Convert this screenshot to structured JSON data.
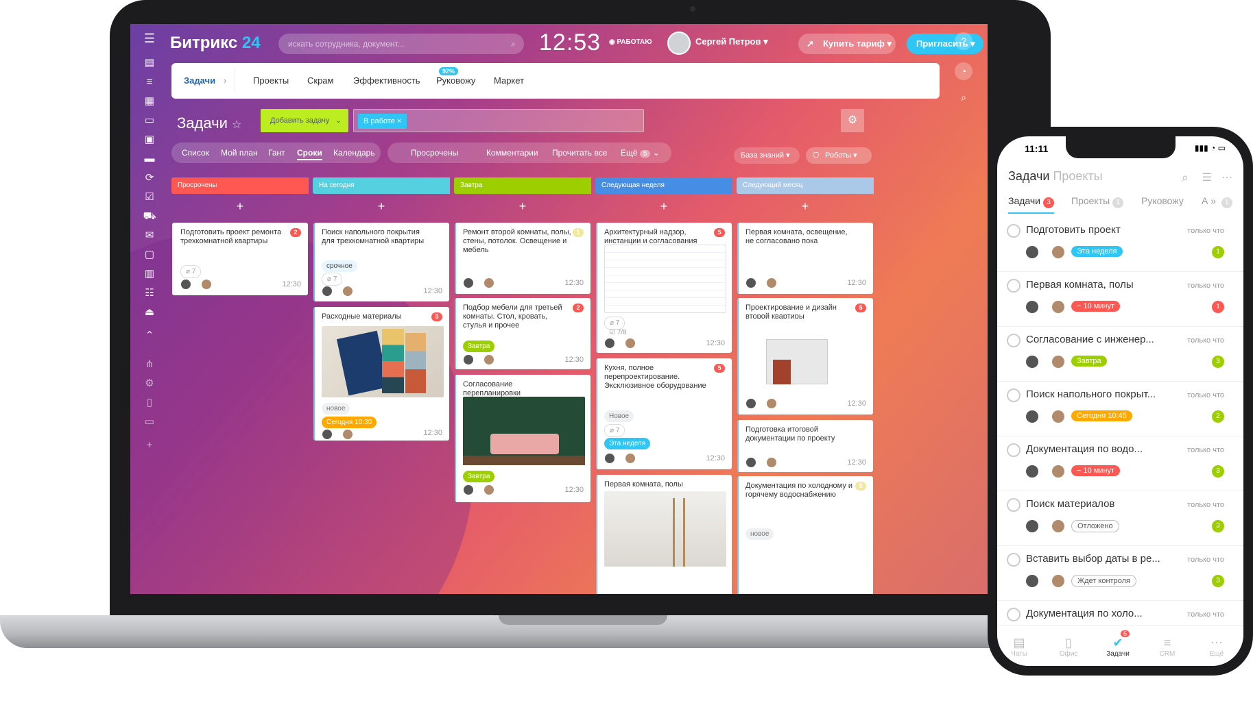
{
  "header": {
    "logo_main": "Битрикс",
    "logo_num": "24",
    "search_placeholder": "искать сотрудника, документ...",
    "clock": "12:53",
    "work_status": "РАБОТАЮ",
    "user_name": "Сергей Петров",
    "buy_label": "Купить тариф",
    "invite_label": "Пригласить"
  },
  "top_menu": {
    "items": [
      "Задачи",
      "Проекты",
      "Скрам",
      "Эффективность",
      "Руковожу",
      "Маркет"
    ],
    "efficiency_badge": "92%"
  },
  "toolbar": {
    "title": "Задачи",
    "add_task": "Добавить задачу",
    "filter_chip": "В работе"
  },
  "views": [
    "Список",
    "Мой план",
    "Гант",
    "Сроки",
    "Календарь"
  ],
  "counters": {
    "overdue": "Просрочены",
    "comments": "Комментарии",
    "read_all": "Прочитать все",
    "more": "Ещё",
    "more_count": "5"
  },
  "right_tools": {
    "knowledge": "База знаний",
    "robots": "Роботы"
  },
  "columns": [
    {
      "title": "Просрочены",
      "color": "#ff5752"
    },
    {
      "title": "На сегодня",
      "color": "#55d0e0"
    },
    {
      "title": "Завтра",
      "color": "#9dcf00"
    },
    {
      "title": "Следующая неделя",
      "color": "#468ee5"
    },
    {
      "title": "Следующий месяц",
      "color": "#aac8e8"
    }
  ],
  "cards": {
    "c1": {
      "title": "Подготовить проект ремонта трехкомнатной квартиры",
      "count": "2",
      "files": "7",
      "time": "12:30"
    },
    "c2": {
      "title": "Поиск напольного покрытия для трехкомнатной квартиры",
      "tag": "срочное",
      "files": "7",
      "time": "12:30"
    },
    "c3": {
      "title": "Расходные материалы",
      "count": "5",
      "tag": "новое",
      "deadline": "Сегодня 10:30",
      "time": "12:30"
    },
    "c4": {
      "title": "Ремонт второй комнаты, полы, стены, потолок. Освещение и мебель",
      "count": "1",
      "time": "12:30"
    },
    "c5": {
      "title": "Подбор мебели для третьей комнаты. Стол, кровать, стулья и прочее",
      "count": "2",
      "deadline": "Завтра",
      "time": "12:30"
    },
    "c6": {
      "title": "Согласование перепланировки",
      "deadline": "Завтра",
      "time": "12:30"
    },
    "c7": {
      "title": "Архитектурный надзор, инстанции и согласования",
      "count": "5",
      "files": "7",
      "checklist": "7/8",
      "time": "12:30"
    },
    "c8": {
      "title": "Кухня, полное перепроектирование. Эксклюзивное оборудование",
      "count": "5",
      "tag": "Новое",
      "files": "7",
      "deadline": "Эта неделя",
      "time": "12:30"
    },
    "c9": {
      "title": "Первая комната, полы"
    },
    "c10": {
      "title": "Первая комната, освещение, не согласовано пока",
      "time": "12:30"
    },
    "c11": {
      "title": "Проектирование и дизайн второй квартиры",
      "count": "5",
      "time": "12:30"
    },
    "c12": {
      "title": "Подготовка итоговой документации по проекту",
      "time": "12:30"
    },
    "c13": {
      "title": "Документация по холодному и горячему водоснабжению",
      "count": "5",
      "tag": "новое"
    }
  },
  "phone": {
    "time": "11:11",
    "title": "Задачи",
    "subtitle": "Проекты",
    "tabs": [
      {
        "label": "Задачи",
        "count": "3"
      },
      {
        "label": "Проекты",
        "count": "1"
      },
      {
        "label": "Руковожу",
        "count": ""
      },
      {
        "label": "А",
        "count": "1"
      }
    ],
    "rows": [
      {
        "title": "Подготовить проект",
        "note": "только что",
        "tag": "Эта неделя",
        "tag_color": "#2fc6f6",
        "count": "1",
        "count_red": false
      },
      {
        "title": "Первая комната, полы",
        "note": "только что",
        "tag": "− 10 минут",
        "tag_color": "#ff5752",
        "count": "1",
        "count_red": true
      },
      {
        "title": "Согласование с инженер...",
        "note": "только что",
        "tag": "Завтра",
        "tag_color": "#9dcf00",
        "count": "3",
        "count_red": false
      },
      {
        "title": "Поиск напольного покрыт...",
        "note": "только что",
        "tag": "Сегодня 10:45",
        "tag_color": "#ffa900",
        "count": "2",
        "count_red": false
      },
      {
        "title": "Документация по водо...",
        "note": "только что",
        "tag": "− 10 минут",
        "tag_color": "#ff5752",
        "count": "3",
        "count_red": false
      },
      {
        "title": "Поиск материалов",
        "note": "только что",
        "tag": "Отложено",
        "tag_color": "#ffffff",
        "count": "3",
        "count_red": false
      },
      {
        "title": "Вставить выбор даты в ре...",
        "note": "только что",
        "tag": "Ждет контроля",
        "tag_color": "#ffffff",
        "count": "3",
        "count_red": false
      },
      {
        "title": "Документация по холо...",
        "note": "только что",
        "tag": "",
        "tag_color": "#ffffff",
        "count": "",
        "count_red": false
      }
    ],
    "nav": [
      {
        "label": "Чаты"
      },
      {
        "label": "Офис"
      },
      {
        "label": "Задачи",
        "badge": "5"
      },
      {
        "label": "CRM"
      },
      {
        "label": "Ещё"
      }
    ]
  }
}
